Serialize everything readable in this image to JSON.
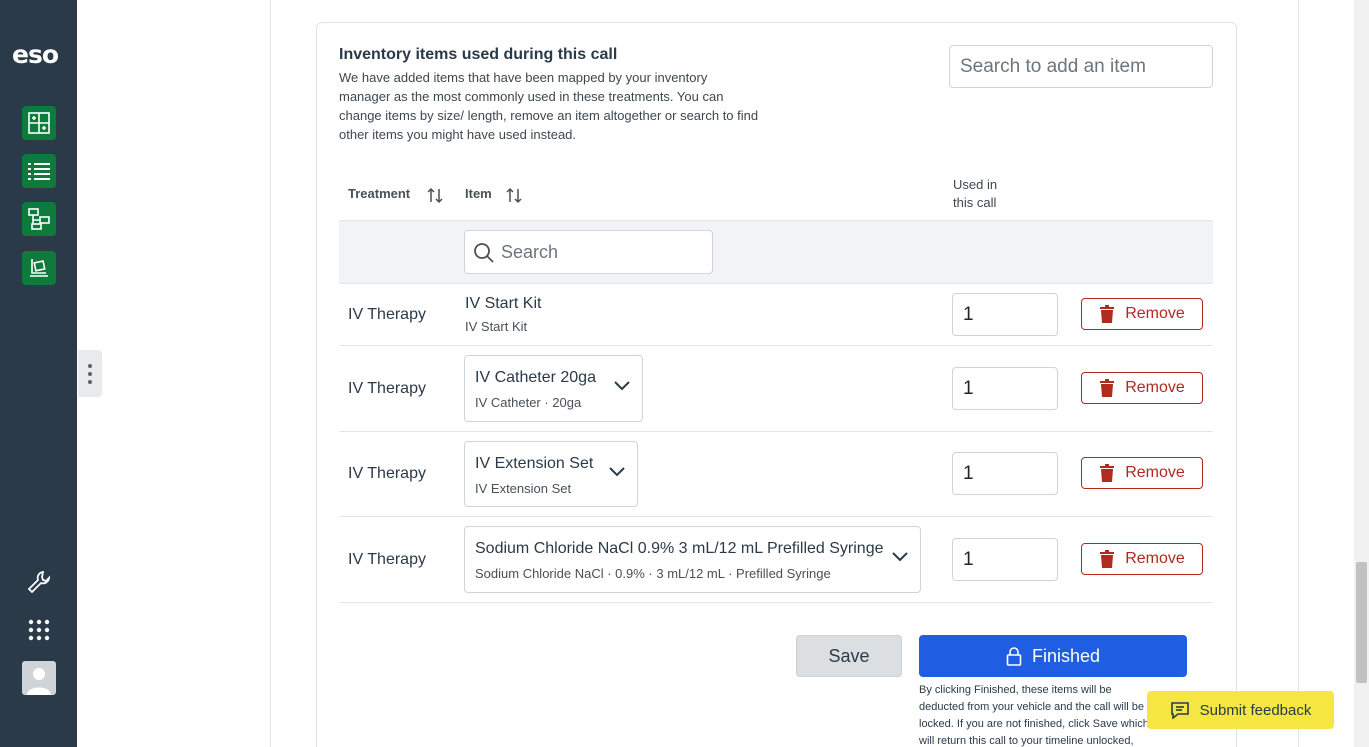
{
  "sidebar": {
    "logo": "eso",
    "icons": [
      "hospital-grid-icon",
      "list-icon",
      "flowchart-icon",
      "cart-icon",
      "wrench-icon",
      "apps-grid-icon",
      "user-avatar"
    ]
  },
  "inventory": {
    "title": "Inventory items used during this call",
    "description": "We have added items that have been mapped by your inventory manager as the most commonly used in these treatments. You can change items by size/ length, remove an item altogether or search to find other items you might have used instead.",
    "add_search_placeholder": "Search to add an item"
  },
  "table": {
    "col_treatment": "Treatment",
    "col_item": "Item",
    "col_used_1": "Used in",
    "col_used_2": "this call",
    "filter_placeholder": "Search",
    "remove_label": "Remove",
    "rows": [
      {
        "treatment": "IV Therapy",
        "item": "IV Start Kit",
        "sub": "IV Start Kit",
        "qty": "1"
      },
      {
        "treatment": "IV Therapy",
        "item": "IV Catheter 20ga",
        "sub": "IV Catheter · 20ga",
        "qty": "1"
      },
      {
        "treatment": "IV Therapy",
        "item": "IV Extension Set",
        "sub": "IV Extension Set",
        "qty": "1"
      },
      {
        "treatment": "IV Therapy",
        "item": "Sodium Chloride NaCl 0.9% 3 mL/12 mL Prefilled Syringe",
        "sub": "Sodium Chloride NaCl · 0.9% · 3 mL/12 mL · Prefilled Syringe",
        "qty": "1"
      }
    ]
  },
  "actions": {
    "save": "Save",
    "finished": "Finished",
    "note": "By clicking Finished, these items will be deducted from your vehicle and the call will be locked. If you are not finished, click Save which will return this call to your timeline unlocked, meaning you"
  },
  "feedback": {
    "label": "Submit feedback"
  },
  "colors": {
    "rail": "#2b3a48",
    "rail_button": "#0e7a3c",
    "primary": "#1f5de3",
    "danger": "#b02a1e",
    "feedback": "#f5e642"
  }
}
